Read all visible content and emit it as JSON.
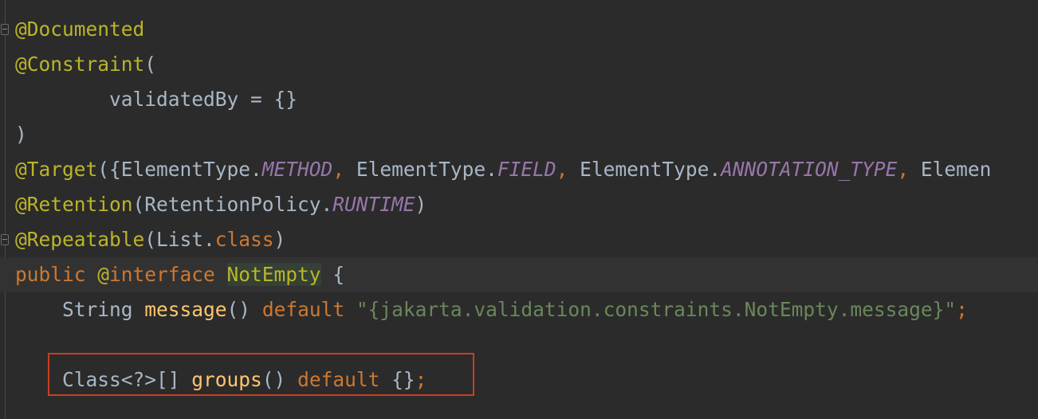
{
  "editor": {
    "lines": [
      {
        "indent": "",
        "tokens": [
          {
            "t": "@Documented",
            "c": "ann"
          }
        ]
      },
      {
        "indent": "",
        "tokens": [
          {
            "t": "@Constraint",
            "c": "ann"
          },
          {
            "t": "(",
            "c": "plain"
          }
        ]
      },
      {
        "indent": "        ",
        "tokens": [
          {
            "t": "validatedBy = {}",
            "c": "plain"
          }
        ]
      },
      {
        "indent": "",
        "tokens": [
          {
            "t": ")",
            "c": "plain"
          }
        ]
      },
      {
        "indent": "",
        "tokens": [
          {
            "t": "@Target",
            "c": "ann"
          },
          {
            "t": "({ElementType.",
            "c": "plain"
          },
          {
            "t": "METHOD",
            "c": "const"
          },
          {
            "t": ", ",
            "c": "kw"
          },
          {
            "t": "ElementType.",
            "c": "plain"
          },
          {
            "t": "FIELD",
            "c": "const"
          },
          {
            "t": ", ",
            "c": "kw"
          },
          {
            "t": "ElementType.",
            "c": "plain"
          },
          {
            "t": "ANNOTATION_TYPE",
            "c": "const"
          },
          {
            "t": ", ",
            "c": "kw"
          },
          {
            "t": "Elemen",
            "c": "plain"
          }
        ]
      },
      {
        "indent": "",
        "tokens": [
          {
            "t": "@Retention",
            "c": "ann"
          },
          {
            "t": "(RetentionPolicy.",
            "c": "plain"
          },
          {
            "t": "RUNTIME",
            "c": "const"
          },
          {
            "t": ")",
            "c": "plain"
          }
        ]
      },
      {
        "indent": "",
        "tokens": [
          {
            "t": "@Repeatable",
            "c": "ann"
          },
          {
            "t": "(List.",
            "c": "plain"
          },
          {
            "t": "class",
            "c": "kw"
          },
          {
            "t": ")",
            "c": "plain"
          }
        ]
      },
      {
        "indent": "",
        "tokens": [
          {
            "t": "public ",
            "c": "kw"
          },
          {
            "t": "@",
            "c": "ann"
          },
          {
            "t": "interface ",
            "c": "kw"
          },
          {
            "t": "NotEmpty",
            "c": "cls-hl"
          },
          {
            "t": " {",
            "c": "plain"
          }
        ]
      },
      {
        "indent": "    ",
        "tokens": [
          {
            "t": "String ",
            "c": "plain"
          },
          {
            "t": "message",
            "c": "fn"
          },
          {
            "t": "() ",
            "c": "plain"
          },
          {
            "t": "default ",
            "c": "kw"
          },
          {
            "t": "\"{jakarta.validation.constraints.NotEmpty.message}\"",
            "c": "str"
          },
          {
            "t": ";",
            "c": "kw"
          }
        ]
      },
      {
        "indent": "",
        "tokens": []
      },
      {
        "indent": "    ",
        "tokens": [
          {
            "t": "Class<?>[] ",
            "c": "plain"
          },
          {
            "t": "groups",
            "c": "fn"
          },
          {
            "t": "() ",
            "c": "plain"
          },
          {
            "t": "default ",
            "c": "kw"
          },
          {
            "t": "{}",
            "c": "plain"
          },
          {
            "t": ";",
            "c": "kw"
          }
        ]
      }
    ]
  }
}
